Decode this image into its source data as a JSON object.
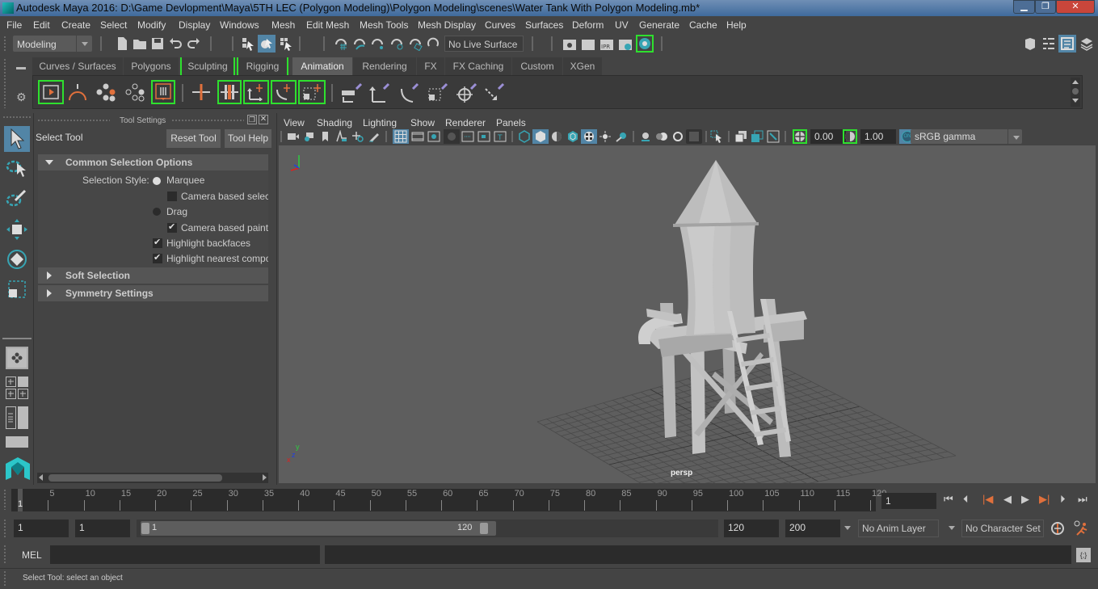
{
  "window": {
    "title": "Autodesk Maya 2016: D:\\Game Devlopment\\Maya\\5TH LEC (Polygon Modeling)\\Polygon Modeling\\scenes\\Water Tank With Polygon Modeling.mb*",
    "controls": [
      "minimize",
      "restore",
      "close"
    ]
  },
  "menubar": {
    "items": [
      "File",
      "Edit",
      "Create",
      "Select",
      "Modify",
      "Display",
      "Windows",
      "Mesh",
      "Edit Mesh",
      "Mesh Tools",
      "Mesh Display",
      "Curves",
      "Surfaces",
      "Deform",
      "UV",
      "Generate",
      "Cache",
      "Help"
    ]
  },
  "statusline": {
    "menu_set": "Modeling",
    "live_surface": "No Live Surface"
  },
  "shelf": {
    "tabs": [
      "Curves / Surfaces",
      "Polygons",
      "Sculpting",
      "Rigging",
      "Animation",
      "Rendering",
      "FX",
      "FX Caching",
      "Custom",
      "XGen"
    ],
    "active_tab": "Animation"
  },
  "tool_settings": {
    "panel_title": "Tool Settings",
    "tool_name": "Select Tool",
    "reset_button": "Reset Tool",
    "help_button": "Tool Help",
    "sections": {
      "common": "Common Selection Options",
      "soft": "Soft Selection",
      "symmetry": "Symmetry Settings"
    },
    "selection_style_label": "Selection Style:",
    "options": {
      "marquee": "Marquee",
      "camera_based_selection": "Camera based selecti",
      "drag": "Drag",
      "camera_based_paint": "Camera based paint s",
      "highlight_backfaces": "Highlight backfaces",
      "highlight_nearest": "Highlight nearest compo"
    },
    "states": {
      "marquee_selected": true,
      "camera_based_selection_checked": false,
      "drag_selected": false,
      "camera_based_paint_checked": true,
      "highlight_backfaces_checked": true,
      "highlight_nearest_checked": true
    }
  },
  "viewport": {
    "menu": [
      "View",
      "Shading",
      "Lighting",
      "Show",
      "Renderer",
      "Panels"
    ],
    "exposure": "0.00",
    "gamma": "1.00",
    "color_mgmt_badge": "ON",
    "color_space": "sRGB gamma",
    "camera_label": "persp",
    "axis": {
      "x": "x",
      "y": "y",
      "z": "z"
    }
  },
  "timeline": {
    "ticks": [
      5,
      10,
      15,
      20,
      25,
      30,
      35,
      40,
      45,
      50,
      55,
      60,
      65,
      70,
      75,
      80,
      85,
      90,
      95,
      100,
      105,
      110,
      115,
      120
    ],
    "current_frame_marker": "1",
    "current_frame": "1"
  },
  "range": {
    "start_time": "1",
    "playback_start": "1",
    "slider_start": "1",
    "slider_end": "120",
    "playback_end": "120",
    "end_time": "200",
    "anim_layer": "No Anim Layer",
    "character_set": "No Character Set"
  },
  "command_line": {
    "language": "MEL",
    "input": "",
    "result": ""
  },
  "help_line": {
    "text": "Select Tool: select an object"
  },
  "colors": {
    "accent_blue": "#5285a6",
    "bracket_green": "#2ee02e",
    "anim_orange": "#e0703c",
    "teal": "#37a5b4"
  }
}
